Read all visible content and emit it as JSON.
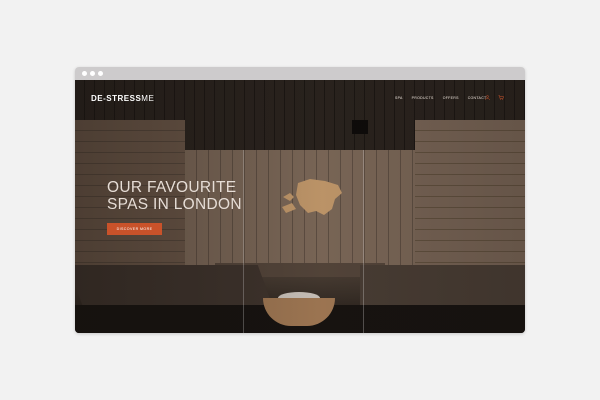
{
  "browser": {
    "controls": [
      "close",
      "minimize",
      "maximize"
    ]
  },
  "site": {
    "logo_prefix": "DE-STRESS",
    "logo_suffix": "ME",
    "nav": {
      "items": [
        {
          "label": "SPA"
        },
        {
          "label": "PRODUCTS"
        },
        {
          "label": "OFFERS"
        },
        {
          "label": "CONTACT"
        }
      ],
      "icons": [
        "user-icon",
        "cart-icon"
      ]
    },
    "hero": {
      "headline_line1": "OUR FAVOURITE",
      "headline_line2": "SPAS IN LONDON",
      "cta_label": "DISCOVER MORE"
    }
  },
  "colors": {
    "accent": "#c9522a",
    "background": "#f2f2f2",
    "titlebar": "#cdcbcc"
  }
}
